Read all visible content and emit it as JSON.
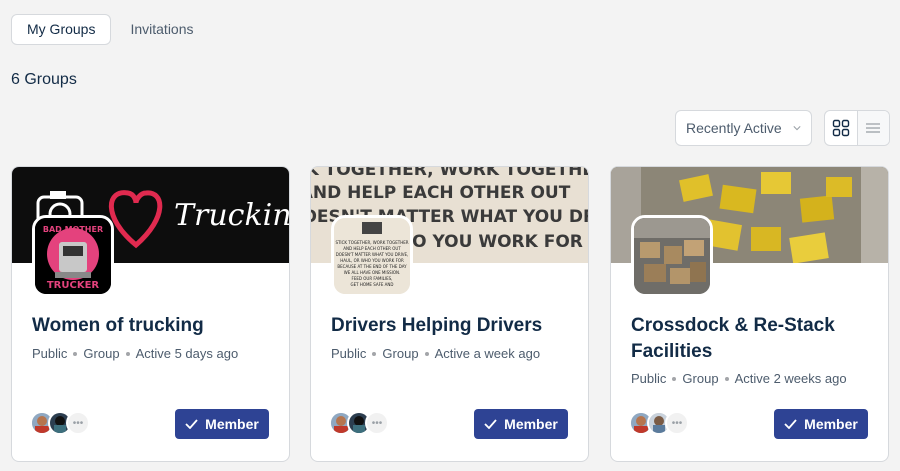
{
  "tabs": [
    {
      "label": "My Groups",
      "active": true
    },
    {
      "label": "Invitations",
      "active": false
    }
  ],
  "count_label": "6 Groups",
  "sort": {
    "selected": "Recently Active"
  },
  "view_toggle": {
    "grid_icon": "grid-icon",
    "list_icon": "list-icon",
    "active": "grid"
  },
  "cards": [
    {
      "title": "Women of trucking",
      "meta": [
        "Public",
        "Group",
        "Active 5 days ago"
      ],
      "member_label": "Member",
      "cover_text": "Trucking",
      "avatar_text": [
        "BAD MOTHER",
        "TRUCKER"
      ]
    },
    {
      "title": "Drivers Helping Drivers",
      "meta": [
        "Public",
        "Group",
        "Active a week ago"
      ],
      "member_label": "Member",
      "cover_lines": [
        "STICK TOGETHER, WORK TOGETHER",
        "AND HELP EACH OTHER OUT",
        "DOESN'T MATTER WHAT YOU DRIVE,",
        "WHO YOU WORK FOR"
      ],
      "avatar_lines": [
        "STICK TOGETHER, WORK TOGETHER",
        "AND HELP EACH OTHER OUT",
        "DOESN'T MATTER WHAT YOU DRIVE,",
        "HAUL, OR WHO YOU WORK FOR",
        "BECAUSE AT THE END OF THE DAY",
        "WE ALL HAVE ONE MISSION.",
        "FEED OUR FAMILIES,",
        "GET HOME SAFE AND"
      ]
    },
    {
      "title": "Crossdock & Re-Stack Facilities",
      "meta": [
        "Public",
        "Group",
        "Active 2 weeks ago"
      ],
      "member_label": "Member"
    }
  ],
  "colors": {
    "primary": "#2e4394",
    "heading": "#122b46",
    "muted": "#4d5c6d"
  }
}
